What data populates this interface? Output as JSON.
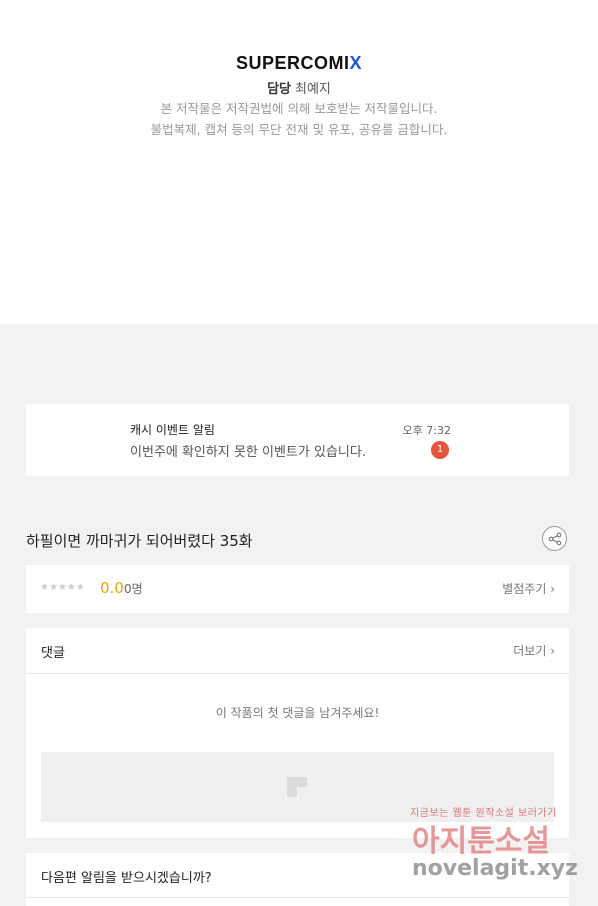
{
  "publisher": {
    "logo_main": "SUPERCOMI",
    "logo_x": "X",
    "credit_label": "담당",
    "credit_name": "최예지",
    "copyright_line1": "본 저작물은 저작권법에 의해 보호받는 저작물입니다.",
    "copyright_line2": "불법복제, 캡쳐 등의 무단 전재 및 유포, 공유를 금합니다."
  },
  "notification": {
    "title": "캐시 이벤트 알림",
    "message": "이번주에 확인하지 못한 이벤트가 있습니다.",
    "time": "오후 7:32",
    "badge_count": "1",
    "badge_color": "#e8533a"
  },
  "episode": {
    "title": "하필이면 까마귀가 되어버렸다 35화",
    "share_icon": "share-icon"
  },
  "rating": {
    "stars": "★★★★★",
    "stars_value": 0,
    "score": "0.0",
    "count": "0명",
    "rate_button": "별점주기 ›"
  },
  "comments": {
    "title": "댓글",
    "more": "더보기 ›",
    "empty_message": "이 작품의 첫 댓글을 남겨주세요!"
  },
  "next_episode": {
    "question": "다음편 알림을 받으시겠습니까?"
  },
  "watermark": {
    "line1": "지금보는 웹툰 원작소설 보러가기",
    "line2": "아지툰소설",
    "line3": "novelagit.xyz"
  },
  "colors": {
    "accent_score": "#f0a400",
    "logo_x": "#1a56db"
  }
}
